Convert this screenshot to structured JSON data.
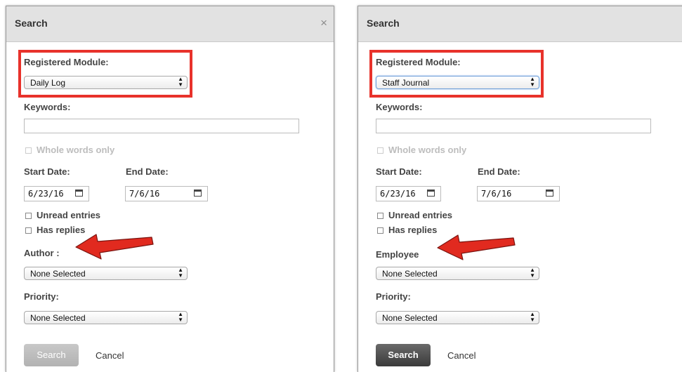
{
  "colors": {
    "highlight": "#e8322b",
    "arrow": "#e12a1f",
    "header_bg": "#e2e2e2"
  },
  "icons": {
    "close": "close-icon",
    "calendar": "calendar-icon",
    "dropdown": "select-arrows-icon"
  },
  "left": {
    "title": "Search",
    "close": "×",
    "module_label": "Registered Module:",
    "module_value": "Daily Log",
    "keywords_label": "Keywords:",
    "whole_words": "Whole words only",
    "start_label": "Start Date:",
    "end_label": "End Date:",
    "start_value": "6/23/16",
    "end_value": "7/6/16",
    "unread": "Unread entries",
    "replies": "Has replies",
    "person_label": "Author :",
    "person_value": "None Selected",
    "priority_label": "Priority:",
    "priority_value": "None Selected",
    "search_button": "Search",
    "cancel": "Cancel"
  },
  "right": {
    "title": "Search",
    "close": "×",
    "module_label": "Registered Module:",
    "module_value": "Staff Journal",
    "keywords_label": "Keywords:",
    "whole_words": "Whole words only",
    "start_label": "Start Date:",
    "end_label": "End Date:",
    "start_value": "6/23/16",
    "end_value": "7/6/16",
    "unread": "Unread entries",
    "replies": "Has replies",
    "person_label": "Employee",
    "person_value": "None Selected",
    "priority_label": "Priority:",
    "priority_value": "None Selected",
    "search_button": "Search",
    "cancel": "Cancel"
  }
}
